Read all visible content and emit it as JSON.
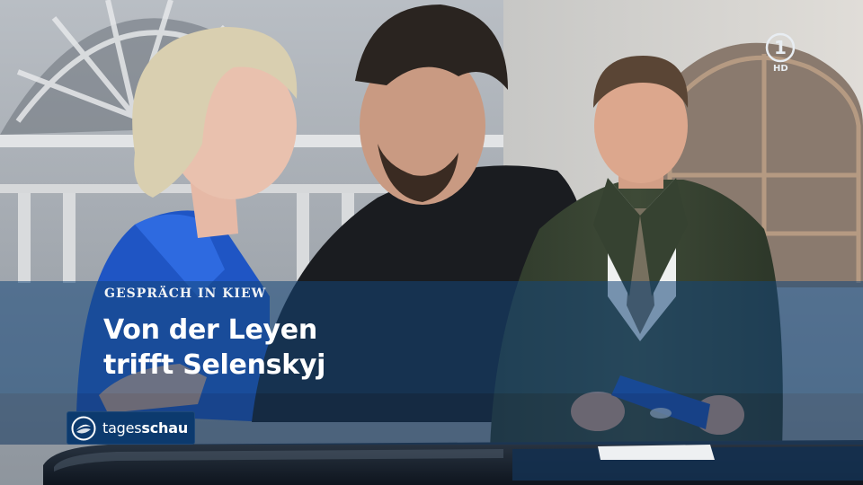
{
  "lower_third": {
    "kicker": "GESPRÄCH IN KIEW",
    "headline_line1": "Von der Leyen",
    "headline_line2": "trifft Selenskyj"
  },
  "brand": {
    "prefix": "tages",
    "suffix": "schau",
    "icon": "tagesschau-logo-icon"
  },
  "channel_logo": {
    "mark": "1",
    "quality": "HD",
    "icon": "ard-das-erste-logo-icon"
  },
  "colors": {
    "band": "#14467a",
    "brand_box": "#0c3a6e",
    "text": "#ffffff"
  }
}
